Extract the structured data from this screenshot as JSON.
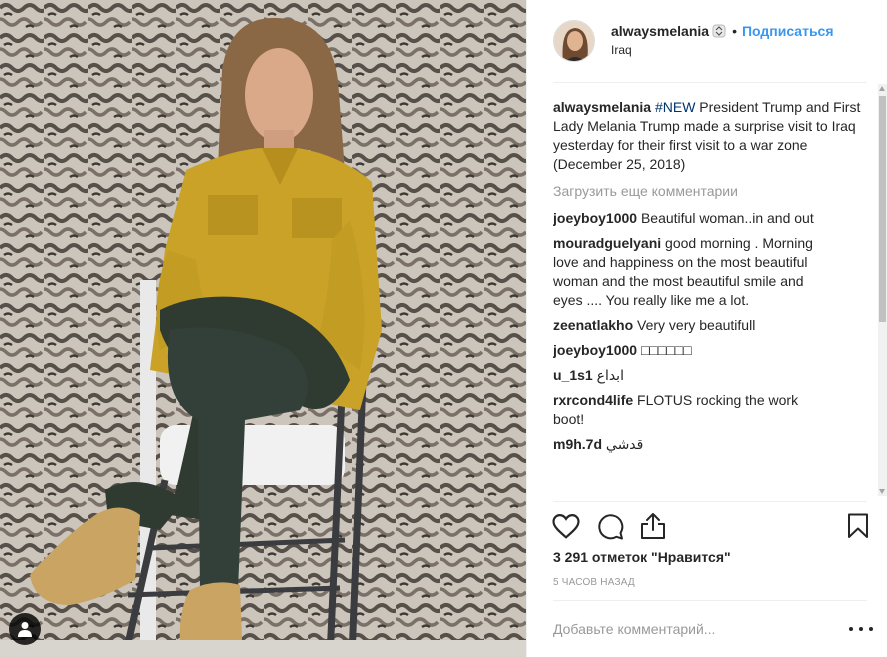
{
  "post": {
    "username": "alwaysmelania",
    "follow_label": "Подписаться",
    "separator": "•",
    "location": "Iraq",
    "caption": {
      "username": "alwaysmelania",
      "hashtag": "#NEW",
      "text": " President Trump and First Lady Melania Trump made a surprise visit to Iraq yesterday for their first visit to a war zone (December 25, 2018)"
    },
    "load_more_label": "Загрузить еще комментарии",
    "comments": [
      {
        "user": "joeyboy1000",
        "text": "Beautiful woman..in and out"
      },
      {
        "user": "mouradguelyani",
        "text": "good morning . Morning love and happiness on the most beautiful woman and the most beautiful smile and eyes .... You really like me a lot."
      },
      {
        "user": "zeenatlakho",
        "text": "Very very beautifull"
      },
      {
        "user": "joeyboy1000",
        "text": "□□□□□□"
      },
      {
        "user": "u_1s1",
        "text": "ابداع"
      },
      {
        "user": "rxrcond4life",
        "text": "FLOTUS rocking the work boot!"
      },
      {
        "user": "m9h.7d",
        "text": "قدشي"
      }
    ],
    "likes_label": "3 291 отметок \"Нравится\"",
    "time_ago": "5 часов назад",
    "add_comment_placeholder": "Добавьте комментарий..."
  },
  "icons": {
    "like": "heart-icon",
    "comment": "comment-bubble-icon",
    "share": "share-icon",
    "save": "bookmark-icon",
    "comment_like": "heart-icon",
    "more": "more-options-icon",
    "tag": "user-tag-icon",
    "verified": "verified-badge-icon"
  },
  "colors": {
    "link": "#3897f0",
    "hashtag": "#003569",
    "muted": "#999999",
    "text": "#262626",
    "jacket": "#c9a227"
  }
}
